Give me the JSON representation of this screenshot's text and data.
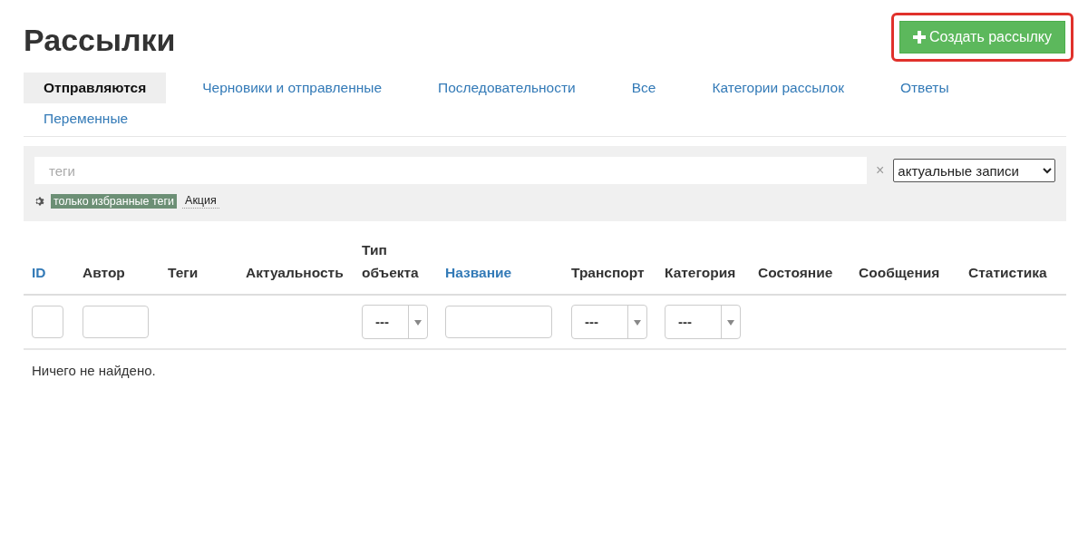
{
  "title": "Рассылки",
  "create_button": {
    "label": "Создать рассылку",
    "highlighted": true
  },
  "tabs": [
    {
      "label": "Отправляются",
      "selected": true
    },
    {
      "label": "Черновики и отправленные",
      "selected": false
    },
    {
      "label": "Последовательности",
      "selected": false
    },
    {
      "label": "Все",
      "selected": false
    },
    {
      "label": "Категории рассылок",
      "selected": false
    },
    {
      "label": "Ответы",
      "selected": false
    },
    {
      "label": "Переменные",
      "selected": false
    }
  ],
  "filter_panel": {
    "tags_placeholder": "теги",
    "clear": "×",
    "period_select": "актуальные записи",
    "tags": [
      {
        "label": "только избранные теги",
        "selected": true
      },
      {
        "label": "Акция",
        "selected": false
      }
    ]
  },
  "table": {
    "columns": [
      {
        "label": "ID",
        "sortable": true,
        "filter": {
          "kind": "input"
        }
      },
      {
        "label": "Автор",
        "sortable": false,
        "filter": {
          "kind": "input"
        }
      },
      {
        "label": "Теги",
        "sortable": false
      },
      {
        "label": "Актуальность",
        "sortable": false
      },
      {
        "label": "Тип объекта",
        "sortable": false,
        "filter": {
          "kind": "select",
          "value": "---"
        }
      },
      {
        "label": "Название",
        "sortable": true,
        "filter": {
          "kind": "input"
        }
      },
      {
        "label": "Транспорт",
        "sortable": false,
        "filter": {
          "kind": "select",
          "value": "---"
        }
      },
      {
        "label": "Категория",
        "sortable": false,
        "filter": {
          "kind": "select",
          "value": "---"
        }
      },
      {
        "label": "Состояние",
        "sortable": false
      },
      {
        "label": "Сообщения",
        "sortable": false
      },
      {
        "label": "Статистика",
        "sortable": false
      }
    ],
    "empty_message": "Ничего не найдено."
  }
}
